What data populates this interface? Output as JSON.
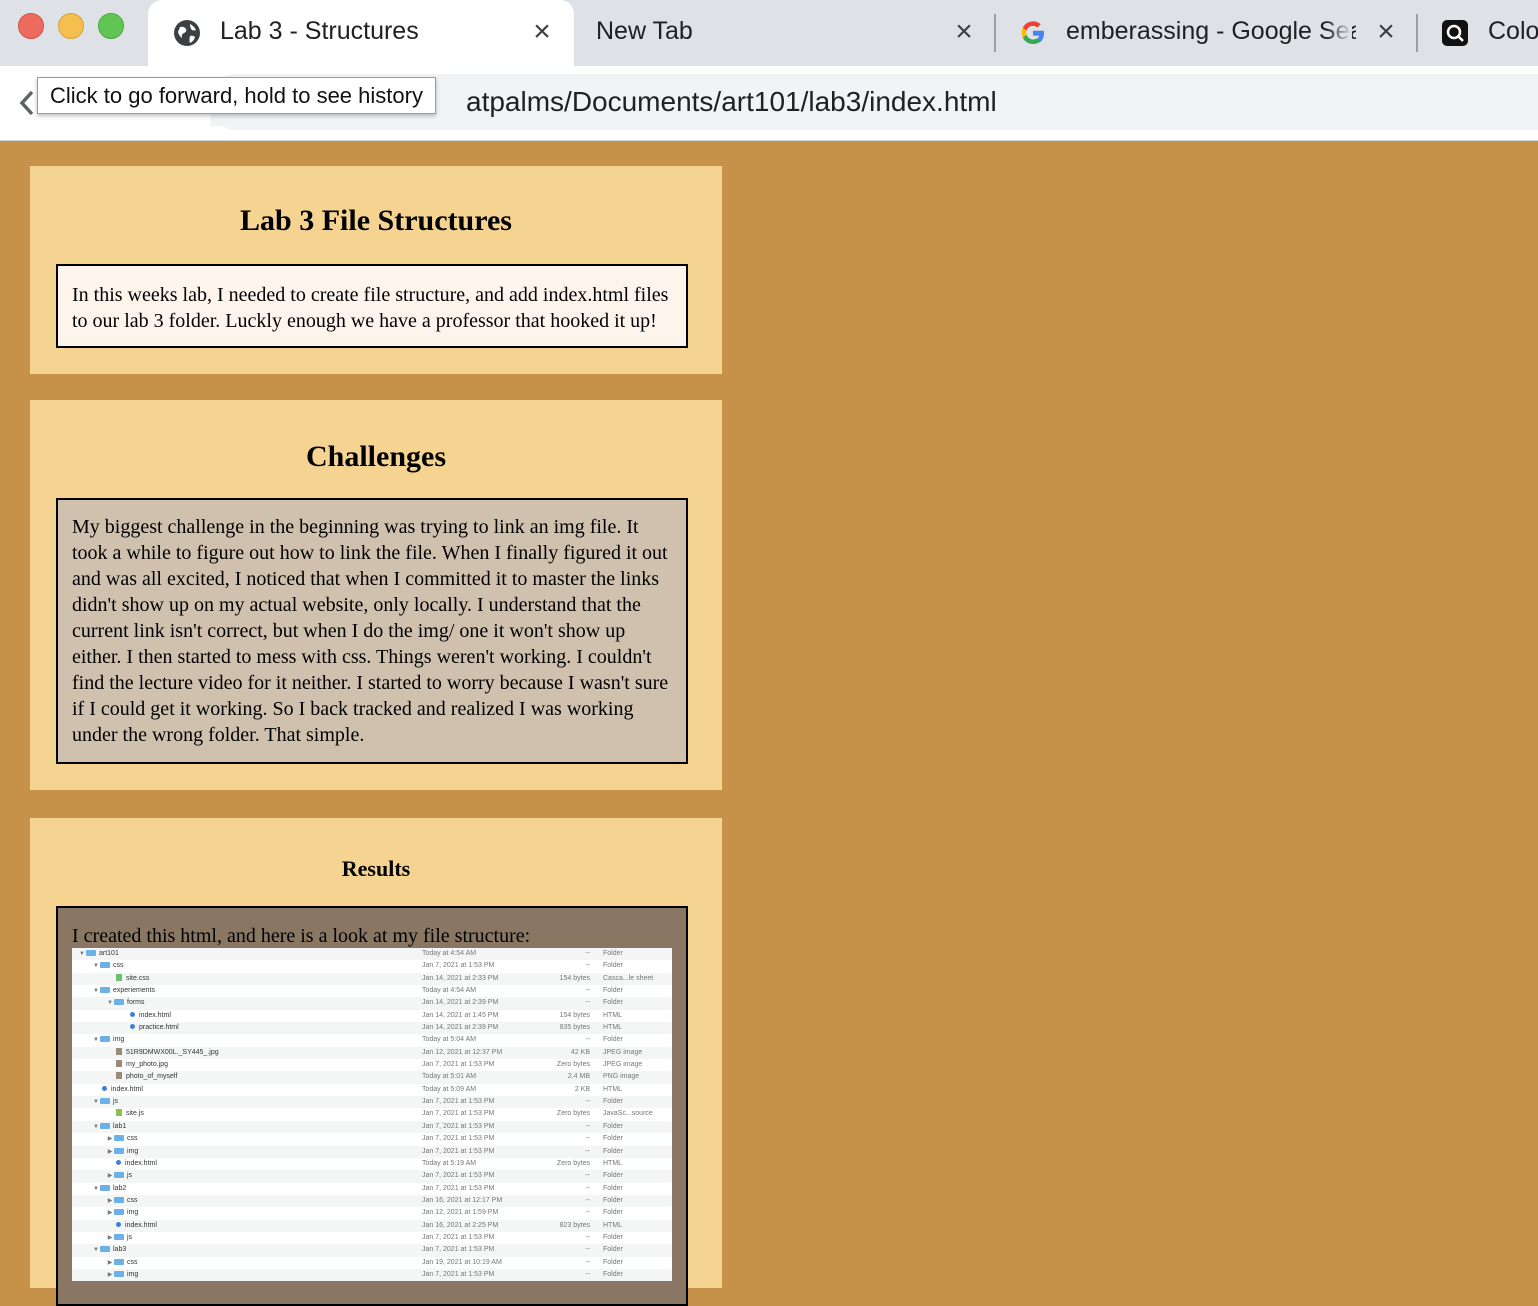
{
  "browser": {
    "tabs": [
      {
        "title": "Lab 3 - Structures",
        "icon": "globe-icon",
        "active": true
      },
      {
        "title": "New Tab",
        "icon": "",
        "active": false
      },
      {
        "title": "emberassing - Google Search",
        "icon": "google-icon",
        "active": false
      },
      {
        "title": "Colo",
        "icon": "app-icon",
        "active": false
      }
    ],
    "url": "atpalms/Documents/art101/lab3/index.html",
    "tooltip": "Click to go forward, hold to see history"
  },
  "page": {
    "background": "#c69249",
    "panel_color": "#f5d390",
    "intro": {
      "heading": "Lab 3 File Structures",
      "text": "In this weeks lab, I needed to create file structure, and add index.html files to our lab 3 folder. Luckly enough we have a professor that hooked it up!"
    },
    "challenges": {
      "heading": "Challenges",
      "text": "My biggest challenge in the beginning was trying to link an img file. It took a while to figure out how to link the file. When I finally figured it out and was all excited, I noticed that when I committed it to master the links didn't show up on my actual website, only locally. I understand that the current link isn't correct, but when I do the img/ one it won't show up either. I then started to mess with css. Things weren't working. I couldn't find the lecture video for it neither. I started to worry because I wasn't sure if I could get it working. So I back tracked and realized I was working under the wrong folder. That simple."
    },
    "results": {
      "heading": "Results",
      "text": "I created this html, and here is a look at my file structure:"
    }
  },
  "file_listing": [
    {
      "depth": 0,
      "disclosure": "open",
      "type": "folder",
      "name": "art101",
      "date": "Today at 4:54 AM",
      "size": "--",
      "kind": "Folder"
    },
    {
      "depth": 1,
      "disclosure": "open",
      "type": "folder",
      "name": "css",
      "date": "Jan 7, 2021 at 1:53 PM",
      "size": "--",
      "kind": "Folder"
    },
    {
      "depth": 2,
      "disclosure": "none",
      "type": "css",
      "name": "site.css",
      "date": "Jan 14, 2021 at 2:33 PM",
      "size": "154 bytes",
      "kind": "Casca...le sheet"
    },
    {
      "depth": 1,
      "disclosure": "open",
      "type": "folder",
      "name": "experiements",
      "date": "Today at 4:54 AM",
      "size": "--",
      "kind": "Folder"
    },
    {
      "depth": 2,
      "disclosure": "open",
      "type": "folder",
      "name": "forms",
      "date": "Jan 14, 2021 at 2:39 PM",
      "size": "--",
      "kind": "Folder"
    },
    {
      "depth": 3,
      "disclosure": "none",
      "type": "html",
      "name": "index.html",
      "date": "Jan 14, 2021 at 1:45 PM",
      "size": "154 bytes",
      "kind": "HTML"
    },
    {
      "depth": 3,
      "disclosure": "none",
      "type": "html",
      "name": "practice.html",
      "date": "Jan 14, 2021 at 2:39 PM",
      "size": "835 bytes",
      "kind": "HTML"
    },
    {
      "depth": 1,
      "disclosure": "open",
      "type": "folder",
      "name": "img",
      "date": "Today at 5:04 AM",
      "size": "--",
      "kind": "Folder"
    },
    {
      "depth": 2,
      "disclosure": "none",
      "type": "img",
      "name": "51R9DMWX00L._SY445_.jpg",
      "date": "Jan 12, 2021 at 12:37 PM",
      "size": "42 KB",
      "kind": "JPEG image"
    },
    {
      "depth": 2,
      "disclosure": "none",
      "type": "img",
      "name": "my_photo.jpg",
      "date": "Jan 7, 2021 at 1:53 PM",
      "size": "Zero bytes",
      "kind": "JPEG image"
    },
    {
      "depth": 2,
      "disclosure": "none",
      "type": "img",
      "name": "photo_of_myself",
      "date": "Today at 5:01 AM",
      "size": "2.4 MB",
      "kind": "PNG image"
    },
    {
      "depth": 1,
      "disclosure": "none",
      "type": "html",
      "name": "index.html",
      "date": "Today at 5:09 AM",
      "size": "2 KB",
      "kind": "HTML"
    },
    {
      "depth": 1,
      "disclosure": "open",
      "type": "folder",
      "name": "js",
      "date": "Jan 7, 2021 at 1:53 PM",
      "size": "--",
      "kind": "Folder"
    },
    {
      "depth": 2,
      "disclosure": "none",
      "type": "js",
      "name": "site.js",
      "date": "Jan 7, 2021 at 1:53 PM",
      "size": "Zero bytes",
      "kind": "JavaSc...source"
    },
    {
      "depth": 1,
      "disclosure": "open",
      "type": "folder",
      "name": "lab1",
      "date": "Jan 7, 2021 at 1:53 PM",
      "size": "--",
      "kind": "Folder"
    },
    {
      "depth": 2,
      "disclosure": "closed",
      "type": "folder",
      "name": "css",
      "date": "Jan 7, 2021 at 1:53 PM",
      "size": "--",
      "kind": "Folder"
    },
    {
      "depth": 2,
      "disclosure": "closed",
      "type": "folder",
      "name": "img",
      "date": "Jan 7, 2021 at 1:53 PM",
      "size": "--",
      "kind": "Folder"
    },
    {
      "depth": 2,
      "disclosure": "none",
      "type": "html",
      "name": "index.html",
      "date": "Today at 5:19 AM",
      "size": "Zero bytes",
      "kind": "HTML"
    },
    {
      "depth": 2,
      "disclosure": "closed",
      "type": "folder",
      "name": "js",
      "date": "Jan 7, 2021 at 1:53 PM",
      "size": "--",
      "kind": "Folder"
    },
    {
      "depth": 1,
      "disclosure": "open",
      "type": "folder",
      "name": "lab2",
      "date": "Jan 7, 2021 at 1:53 PM",
      "size": "--",
      "kind": "Folder"
    },
    {
      "depth": 2,
      "disclosure": "closed",
      "type": "folder",
      "name": "css",
      "date": "Jan 16, 2021 at 12:17 PM",
      "size": "--",
      "kind": "Folder"
    },
    {
      "depth": 2,
      "disclosure": "closed",
      "type": "folder",
      "name": "img",
      "date": "Jan 12, 2021 at 1:59 PM",
      "size": "--",
      "kind": "Folder"
    },
    {
      "depth": 2,
      "disclosure": "none",
      "type": "html",
      "name": "index.html",
      "date": "Jan 16, 2021 at 2:25 PM",
      "size": "823 bytes",
      "kind": "HTML"
    },
    {
      "depth": 2,
      "disclosure": "closed",
      "type": "folder",
      "name": "js",
      "date": "Jan 7, 2021 at 1:53 PM",
      "size": "--",
      "kind": "Folder"
    },
    {
      "depth": 1,
      "disclosure": "open",
      "type": "folder",
      "name": "lab3",
      "date": "Jan 7, 2021 at 1:53 PM",
      "size": "--",
      "kind": "Folder"
    },
    {
      "depth": 2,
      "disclosure": "closed",
      "type": "folder",
      "name": "css",
      "date": "Jan 19, 2021 at 10:19 AM",
      "size": "--",
      "kind": "Folder"
    },
    {
      "depth": 2,
      "disclosure": "closed",
      "type": "folder",
      "name": "img",
      "date": "Jan 7, 2021 at 1:53 PM",
      "size": "--",
      "kind": "Folder"
    }
  ]
}
